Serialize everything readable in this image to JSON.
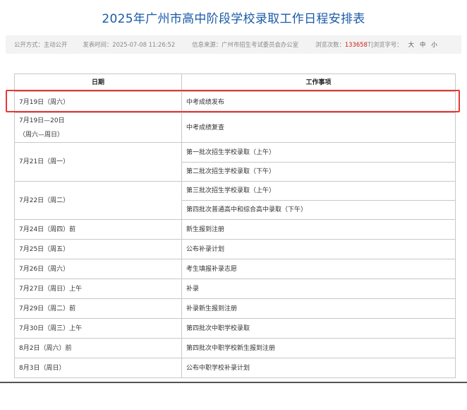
{
  "page": {
    "title": "2025年广州市高中阶段学校录取工作日程安排表"
  },
  "meta": {
    "open_mode_label": "公开方式：",
    "open_mode": "主动公开",
    "publish_time_label": "发表时间：",
    "publish_time": "2025-07-08 11:26:52",
    "source_label": "信息来源：",
    "source": "广州市招生考试委员会办公室",
    "views_label": "浏览次数：",
    "views": "133658",
    "font_size_label": "T|浏览字号：",
    "font_large": "大",
    "font_medium": "中",
    "font_small": "小"
  },
  "table": {
    "headers": [
      "日期",
      "工作事项"
    ],
    "rows": [
      {
        "date": "7月19日（周六）",
        "items": [
          "中考成绩发布"
        ]
      },
      {
        "date": "7月19日—20日",
        "date2": "（周六—周日）",
        "items": [
          "中考成绩复查"
        ]
      },
      {
        "date": "7月21日（周一）",
        "items": [
          "第一批次招生学校录取（上午）",
          "第二批次招生学校录取（下午）"
        ]
      },
      {
        "date": "7月22日（周二）",
        "items": [
          "第三批次招生学校录取（上午）",
          "第四批次普通高中和综合高中录取（下午）"
        ]
      },
      {
        "date": "7月24日（周四）前",
        "items": [
          "新生报到注册"
        ]
      },
      {
        "date": "7月25日（周五）",
        "items": [
          "公布补录计划"
        ]
      },
      {
        "date": "7月26日（周六）",
        "items": [
          "考生填报补录志愿"
        ]
      },
      {
        "date": "7月27日（周日）上午",
        "items": [
          "补录"
        ]
      },
      {
        "date": "7月29日（周二）前",
        "items": [
          "补录新生报到注册"
        ]
      },
      {
        "date": "7月30日（周三）上午",
        "items": [
          "第四批次中职学校录取"
        ]
      },
      {
        "date": "8月2日（周六）前",
        "items": [
          "第四批次中职学校新生报到注册"
        ]
      },
      {
        "date": "8月3日（周日）",
        "items": [
          "公布中职学校补录计划"
        ]
      }
    ]
  }
}
